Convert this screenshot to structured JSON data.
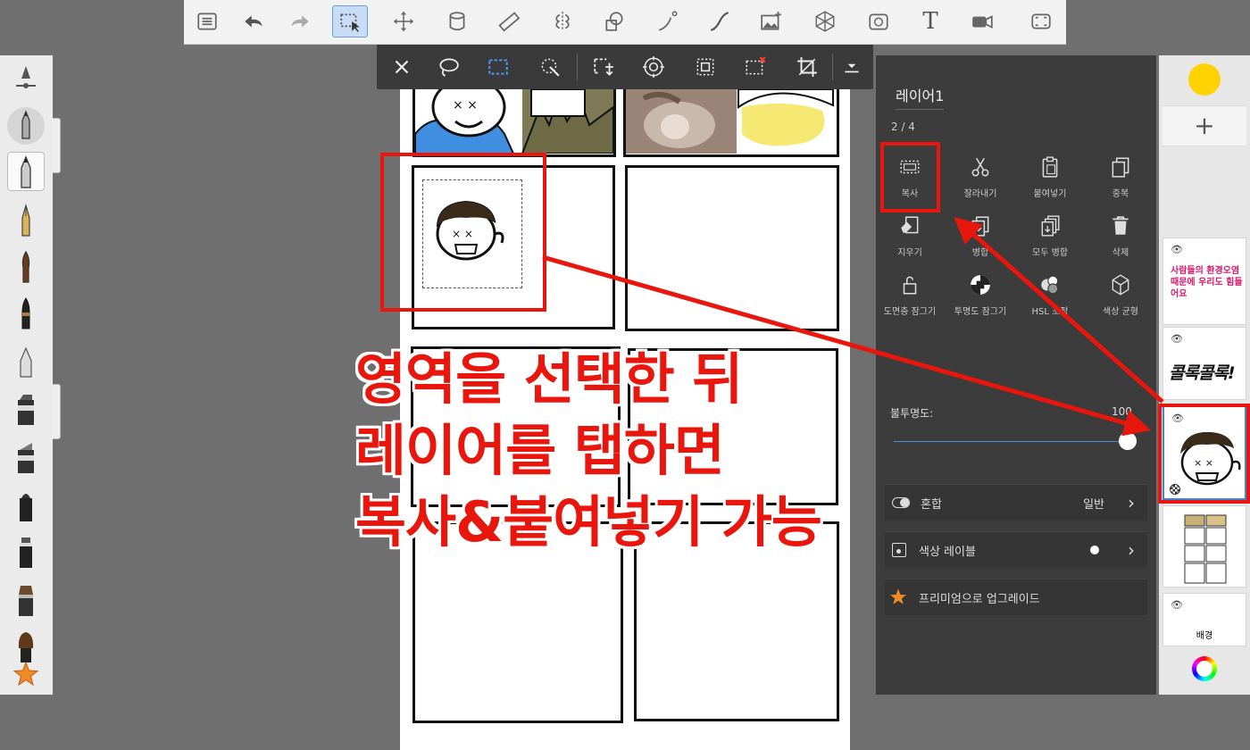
{
  "top_toolbar": {
    "icons": [
      "list-icon",
      "undo-icon",
      "redo-icon",
      "selection-icon",
      "transform-icon",
      "fill-icon",
      "ruler-icon",
      "symmetry-icon",
      "shapes-icon",
      "perspective-icon",
      "curve-icon",
      "image-insert-icon",
      "grid-3d-icon",
      "timelapse-icon",
      "text-icon",
      "video-icon",
      "fullscreen-icon"
    ],
    "text_tool_label": "T"
  },
  "selection_toolbar": {
    "icons": [
      "close-icon",
      "lasso-icon",
      "rect-select-icon",
      "magic-wand-icon",
      "transform-select-icon",
      "select-center-icon",
      "select-all-icon",
      "deselect-icon",
      "crop-icon",
      "more-icon"
    ]
  },
  "layer_panel": {
    "layer_name": "레이어1",
    "layer_count": "2 / 4",
    "commands": [
      {
        "label": "복사",
        "icon": "copy-selection-icon"
      },
      {
        "label": "잘라내기",
        "icon": "scissors-icon"
      },
      {
        "label": "붙여넣기",
        "icon": "paste-icon"
      },
      {
        "label": "중복",
        "icon": "duplicate-icon"
      },
      {
        "label": "지우기",
        "icon": "clear-icon"
      },
      {
        "label": "병합",
        "icon": "merge-icon"
      },
      {
        "label": "모두 병합",
        "icon": "merge-all-icon"
      },
      {
        "label": "삭제",
        "icon": "trash-icon"
      },
      {
        "label": "도면층 잠그기",
        "icon": "lock-icon"
      },
      {
        "label": "투명도 잠그기",
        "icon": "transparency-lock-icon"
      },
      {
        "label": "HSL 조정",
        "icon": "hsl-icon"
      },
      {
        "label": "색상 균형",
        "icon": "color-balance-icon"
      }
    ],
    "opacity_label": "불투명도:",
    "opacity_value": "100",
    "opacity_fraction": 1.0,
    "blend_label": "혼합",
    "blend_value": "일반",
    "color_label": "색상 레이블",
    "upgrade_label": "프리미엄으로 업그레이드"
  },
  "layers": {
    "current_color": "#ffd200",
    "add_label": "+",
    "items": [
      {
        "text": "사람들의 환경오염 때문에 우리도 힘들어요",
        "color": "#e0156b"
      },
      {
        "text": "콜록콜록!",
        "color": "#111111"
      },
      {
        "text": "",
        "color": "#111111"
      },
      {
        "text": "",
        "color": "#111111"
      },
      {
        "text": "배경",
        "color": "#333333"
      }
    ]
  },
  "canvas": {
    "bg_text_1": "콜록콜록",
    "bg_text_2": "사람들의 환경오염"
  },
  "annotation": {
    "line1": "영역을 선택한 뒤",
    "line2": "레이어를 탭하면",
    "line3": "복사&붙여넣기 가능",
    "color": "#e8160c"
  }
}
